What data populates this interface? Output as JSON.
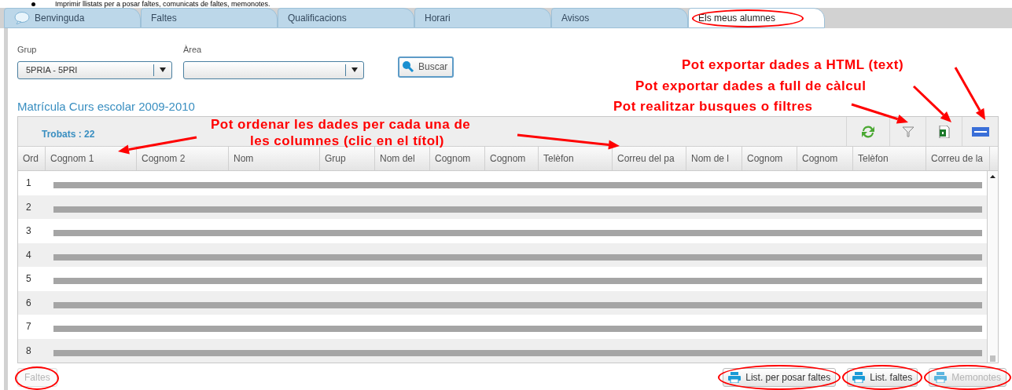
{
  "doc_line": "Imprimir llistats per a posar faltes, comunicats de faltes, memonotes.",
  "tabs": [
    {
      "label": "Benvinguda",
      "selected": false,
      "has_icon": true,
      "circled": false
    },
    {
      "label": "Faltes",
      "selected": false,
      "has_icon": false,
      "circled": false
    },
    {
      "label": "Qualificacions",
      "selected": false,
      "has_icon": false,
      "circled": false
    },
    {
      "label": "Horari",
      "selected": false,
      "has_icon": false,
      "circled": false
    },
    {
      "label": "Avisos",
      "selected": false,
      "has_icon": false,
      "circled": false
    },
    {
      "label": "Els meus alumnes",
      "selected": true,
      "has_icon": false,
      "circled": true
    }
  ],
  "filters": [
    {
      "label": "Grup",
      "value": "5PRIA - 5PRI"
    },
    {
      "label": "Àrea"
    }
  ],
  "search_button": "Buscar",
  "section_title": "Matrícula Curs escolar 2009-2010",
  "grid": {
    "found": "Trobats : 22",
    "columns": [
      "Ord",
      "Cognom 1",
      "Cognom 2",
      "Nom",
      "Grup",
      "Nom del",
      "Cognom",
      "Cognom",
      "Telèfon",
      "Correu del pa",
      "Nom de l",
      "Cognom",
      "Cognom",
      "Telèfon",
      "Correu de la"
    ],
    "rows": [
      {
        "number": "1"
      },
      {
        "number": "2"
      },
      {
        "number": "3"
      },
      {
        "number": "4"
      },
      {
        "number": "5"
      },
      {
        "number": "6"
      },
      {
        "number": "7"
      },
      {
        "number": "8"
      }
    ]
  },
  "footer": {
    "left_buttons": [
      {
        "label": "Faltes",
        "disabled": true,
        "circled": true
      }
    ],
    "right_buttons": [
      {
        "label": "List. per posar faltes",
        "disabled": false,
        "circled": true
      },
      {
        "label": "List. faltes",
        "disabled": false,
        "circled": true
      },
      {
        "label": "Memonotes",
        "disabled": true,
        "circled": true
      }
    ]
  },
  "annotations": [
    {
      "text": "Pot ordenar les dades per cada una de"
    },
    {
      "text": "les columnes (clic en el títol)"
    },
    {
      "text": "Pot exportar dades a HTML (text)"
    },
    {
      "text": "Pot exportar dades a full de càlcul"
    },
    {
      "text": "Pot realitzar busques o filtres"
    }
  ]
}
